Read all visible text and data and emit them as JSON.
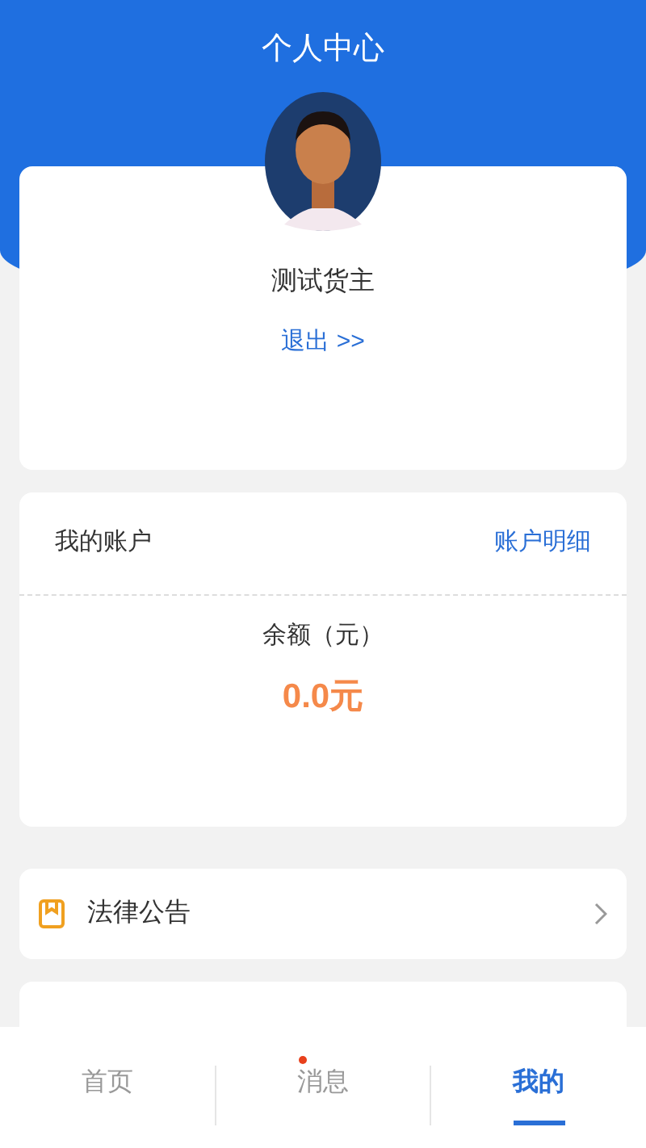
{
  "header": {
    "title": "个人中心"
  },
  "profile": {
    "name": "测试货主",
    "logout": "退出 >>"
  },
  "account": {
    "title": "我的账户",
    "detail_link": "账户明细",
    "balance_label": "余额（元）",
    "balance": "0.0元"
  },
  "menu": [
    {
      "kind": "notice",
      "label": "法律公告"
    }
  ],
  "tabs": [
    {
      "label": "首页",
      "selected": false,
      "badge": false
    },
    {
      "label": "消息",
      "selected": false,
      "badge": true
    },
    {
      "label": "我的",
      "selected": true,
      "badge": false
    }
  ]
}
